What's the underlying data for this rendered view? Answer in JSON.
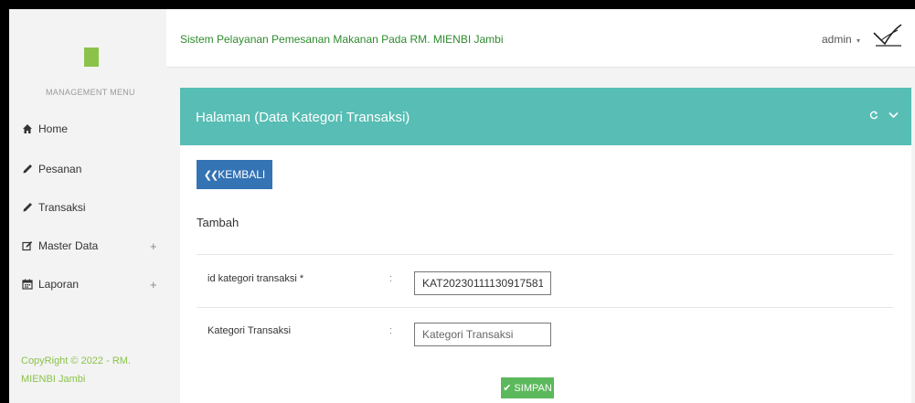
{
  "sidebar": {
    "caption": "MANAGEMENT MENU",
    "items": [
      {
        "label": "Home",
        "icon": "home-icon"
      },
      {
        "label": "Pesanan",
        "icon": "pencil-icon"
      },
      {
        "label": "Transaksi",
        "icon": "pencil-icon"
      },
      {
        "label": "Master Data",
        "icon": "edit-icon",
        "expand": "+"
      },
      {
        "label": "Laporan",
        "icon": "calendar-icon",
        "expand": "+"
      }
    ],
    "copyright": "CopyRight © 2022 - RM. MIENBI Jambi"
  },
  "header": {
    "title": "Sistem Pelayanan Pemesanan Makanan Pada RM. MIENBI Jambi",
    "user": "admin",
    "user_caret": "▾"
  },
  "box": {
    "title": "Halaman (Data Kategori Transaksi)",
    "back_label": "KEMBALI",
    "back_arrows": "❮❮",
    "section": "Tambah",
    "fields": [
      {
        "label": "id kategori transaksi *",
        "colon": ":",
        "value": "KAT20230111130917581",
        "placeholder": ""
      },
      {
        "label": "Kategori Transaksi",
        "colon": ":",
        "value": "",
        "placeholder": "Kategori Transaksi"
      }
    ],
    "save_label": "SIMPAN",
    "save_check": "✔"
  },
  "colors": {
    "header_teal": "#58bdb4",
    "brand_green": "#8bc34a",
    "title_green": "#2e8b2e",
    "back_blue": "#3473b4",
    "save_green": "#5cb85c"
  }
}
